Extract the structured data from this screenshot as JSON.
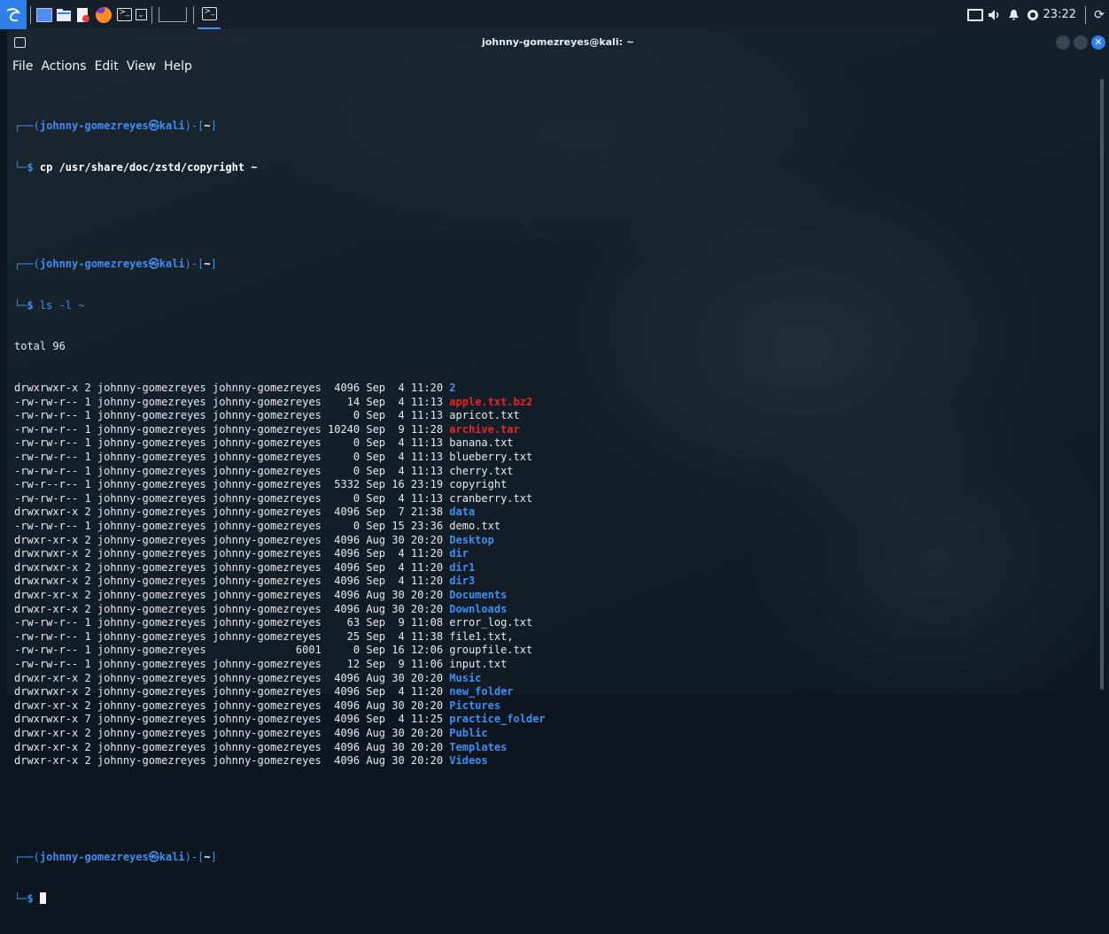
{
  "panel": {
    "launchers": [
      "kali-menu-icon",
      "workspace-icon",
      "file-manager-icon",
      "text-editor-icon",
      "firefox-icon",
      "terminal-icon",
      "chevron-down-icon",
      "window-button",
      "terminal-task-icon"
    ],
    "clock": "23:22",
    "tray_icons": [
      "display-icon",
      "volume-icon",
      "bell-icon",
      "network-icon",
      "power-icon"
    ]
  },
  "window": {
    "title": "johnny-gomezreyes@kali: ~",
    "menu": [
      "File",
      "Actions",
      "Edit",
      "View",
      "Help"
    ],
    "colors": {
      "accent": "#3f8ef5",
      "red": "#e5252a",
      "close": "#2f7fe8"
    }
  },
  "terminal": {
    "prompt_user": "johnny-gomezreyes",
    "prompt_host": "kali",
    "prompt_dir": "~",
    "cmd1": "cp /usr/share/doc/zstd/copyright ~",
    "cmd2": "ls -l ~",
    "total": "total 96",
    "rows": [
      {
        "prefix": "drwxrwxr-x 2 johnny-gomezreyes johnny-gomezreyes  4096 Sep  4 11:20 ",
        "name": "2",
        "color": "blue"
      },
      {
        "prefix": "-rw-rw-r-- 1 johnny-gomezreyes johnny-gomezreyes    14 Sep  4 11:13 ",
        "name": "apple.txt.bz2",
        "color": "red"
      },
      {
        "prefix": "-rw-rw-r-- 1 johnny-gomezreyes johnny-gomezreyes     0 Sep  4 11:13 ",
        "name": "apricot.txt",
        "color": "plain"
      },
      {
        "prefix": "-rw-rw-r-- 1 johnny-gomezreyes johnny-gomezreyes 10240 Sep  9 11:28 ",
        "name": "archive.tar",
        "color": "red"
      },
      {
        "prefix": "-rw-rw-r-- 1 johnny-gomezreyes johnny-gomezreyes     0 Sep  4 11:13 ",
        "name": "banana.txt",
        "color": "plain"
      },
      {
        "prefix": "-rw-rw-r-- 1 johnny-gomezreyes johnny-gomezreyes     0 Sep  4 11:13 ",
        "name": "blueberry.txt",
        "color": "plain"
      },
      {
        "prefix": "-rw-rw-r-- 1 johnny-gomezreyes johnny-gomezreyes     0 Sep  4 11:13 ",
        "name": "cherry.txt",
        "color": "plain"
      },
      {
        "prefix": "-rw-r--r-- 1 johnny-gomezreyes johnny-gomezreyes  5332 Sep 16 23:19 ",
        "name": "copyright",
        "color": "plain"
      },
      {
        "prefix": "-rw-rw-r-- 1 johnny-gomezreyes johnny-gomezreyes     0 Sep  4 11:13 ",
        "name": "cranberry.txt",
        "color": "plain"
      },
      {
        "prefix": "drwxrwxr-x 2 johnny-gomezreyes johnny-gomezreyes  4096 Sep  7 21:38 ",
        "name": "data",
        "color": "blue"
      },
      {
        "prefix": "-rw-rw-r-- 1 johnny-gomezreyes johnny-gomezreyes     0 Sep 15 23:36 ",
        "name": "demo.txt",
        "color": "plain"
      },
      {
        "prefix": "drwxr-xr-x 2 johnny-gomezreyes johnny-gomezreyes  4096 Aug 30 20:20 ",
        "name": "Desktop",
        "color": "blue"
      },
      {
        "prefix": "drwxrwxr-x 2 johnny-gomezreyes johnny-gomezreyes  4096 Sep  4 11:20 ",
        "name": "dir",
        "color": "blue"
      },
      {
        "prefix": "drwxrwxr-x 2 johnny-gomezreyes johnny-gomezreyes  4096 Sep  4 11:20 ",
        "name": "dir1",
        "color": "blue"
      },
      {
        "prefix": "drwxrwxr-x 2 johnny-gomezreyes johnny-gomezreyes  4096 Sep  4 11:20 ",
        "name": "dir3",
        "color": "blue"
      },
      {
        "prefix": "drwxr-xr-x 2 johnny-gomezreyes johnny-gomezreyes  4096 Aug 30 20:20 ",
        "name": "Documents",
        "color": "blue"
      },
      {
        "prefix": "drwxr-xr-x 2 johnny-gomezreyes johnny-gomezreyes  4096 Aug 30 20:20 ",
        "name": "Downloads",
        "color": "blue"
      },
      {
        "prefix": "-rw-rw-r-- 1 johnny-gomezreyes johnny-gomezreyes    63 Sep  9 11:08 ",
        "name": "error_log.txt",
        "color": "plain"
      },
      {
        "prefix": "-rw-rw-r-- 1 johnny-gomezreyes johnny-gomezreyes    25 Sep  4 11:38 ",
        "name": "file1.txt,",
        "color": "plain"
      },
      {
        "prefix": "-rw-rw-r-- 1 johnny-gomezreyes              6001     0 Sep 16 12:06 ",
        "name": "groupfile.txt",
        "color": "plain"
      },
      {
        "prefix": "-rw-rw-r-- 1 johnny-gomezreyes johnny-gomezreyes    12 Sep  9 11:06 ",
        "name": "input.txt",
        "color": "plain"
      },
      {
        "prefix": "drwxr-xr-x 2 johnny-gomezreyes johnny-gomezreyes  4096 Aug 30 20:20 ",
        "name": "Music",
        "color": "blue"
      },
      {
        "prefix": "drwxrwxr-x 2 johnny-gomezreyes johnny-gomezreyes  4096 Sep  4 11:20 ",
        "name": "new_folder",
        "color": "blue"
      },
      {
        "prefix": "drwxr-xr-x 2 johnny-gomezreyes johnny-gomezreyes  4096 Aug 30 20:20 ",
        "name": "Pictures",
        "color": "blue"
      },
      {
        "prefix": "drwxrwxr-x 7 johnny-gomezreyes johnny-gomezreyes  4096 Sep  4 11:25 ",
        "name": "practice_folder",
        "color": "blue"
      },
      {
        "prefix": "drwxr-xr-x 2 johnny-gomezreyes johnny-gomezreyes  4096 Aug 30 20:20 ",
        "name": "Public",
        "color": "blue"
      },
      {
        "prefix": "drwxr-xr-x 2 johnny-gomezreyes johnny-gomezreyes  4096 Aug 30 20:20 ",
        "name": "Templates",
        "color": "blue"
      },
      {
        "prefix": "drwxr-xr-x 2 johnny-gomezreyes johnny-gomezreyes  4096 Aug 30 20:20 ",
        "name": "Videos",
        "color": "blue"
      }
    ]
  }
}
